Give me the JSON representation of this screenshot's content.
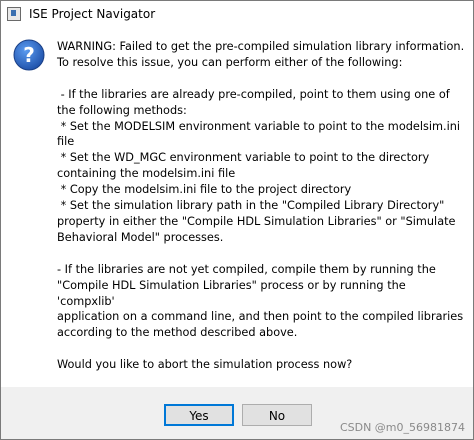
{
  "window": {
    "title": "ISE Project Navigator",
    "icon": "ise-app-icon"
  },
  "dialog": {
    "icon": "question-icon",
    "lines": [
      "WARNING: Failed to get the pre-compiled simulation library information.",
      "To resolve this issue, you can perform either of the following:",
      "",
      " - If the libraries are already pre-compiled, point to them using one of",
      "the following methods:",
      " * Set the MODELSIM environment variable to point to the modelsim.ini",
      "file",
      " * Set the WD_MGC environment variable to point to the directory",
      "containing the modelsim.ini file",
      " * Copy the modelsim.ini file to the project directory",
      " * Set the simulation library path in the \"Compiled Library Directory\"",
      "property in either the \"Compile HDL Simulation Libraries\" or \"Simulate",
      "Behavioral Model\" processes.",
      "",
      "- If the libraries are not yet compiled, compile them by running the",
      "\"Compile HDL Simulation Libraries\" process or by running the 'compxlib'",
      "application on a command line, and then point to the compiled libraries",
      "according to the method described above.",
      "",
      "Would you like to abort the simulation process now?"
    ]
  },
  "buttons": {
    "yes_label": "Yes",
    "no_label": "No"
  },
  "watermark": "CSDN @m0_56981874",
  "colors": {
    "accent": "#0078d7",
    "icon_blue": "#2a64c5"
  }
}
